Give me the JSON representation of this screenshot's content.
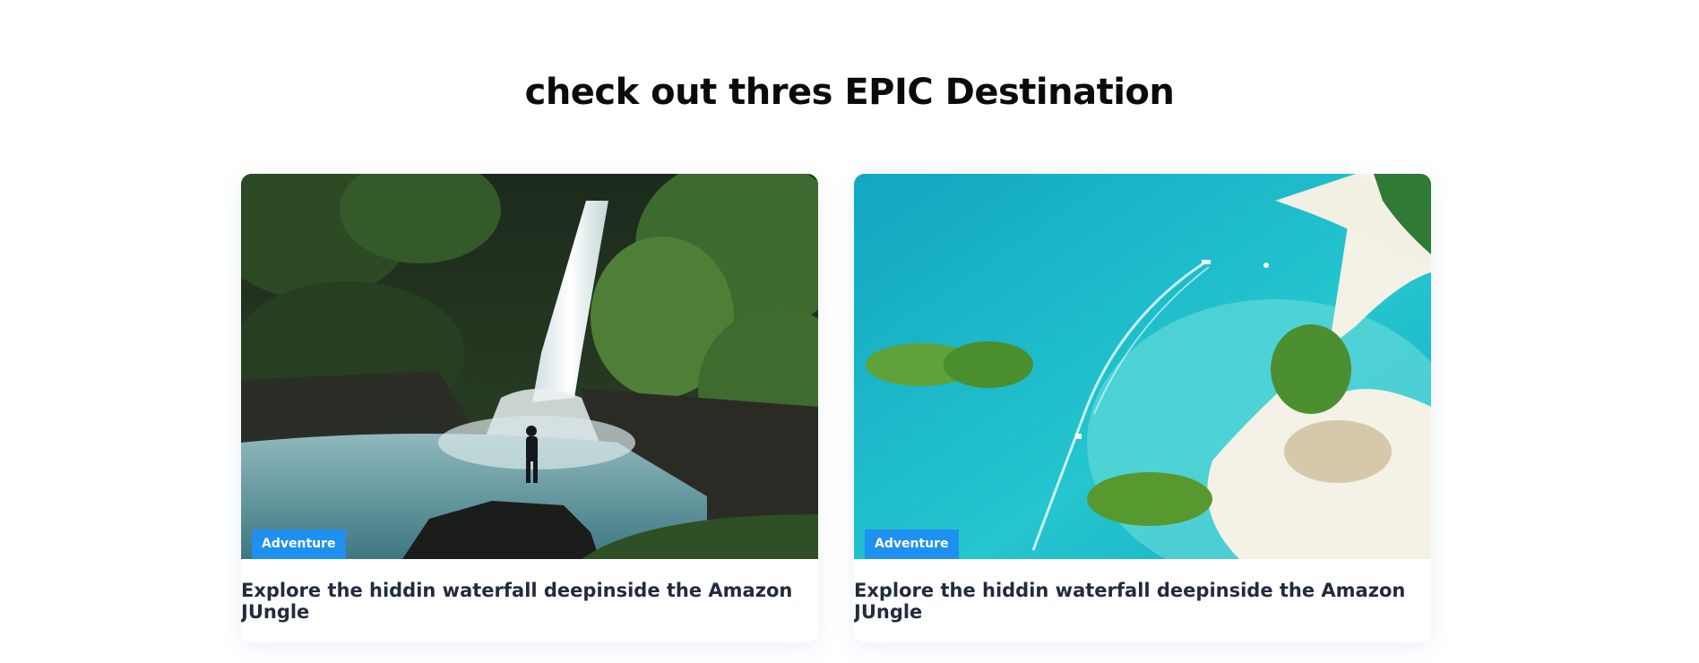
{
  "section": {
    "title": "check out thres EPIC Destination"
  },
  "cards": [
    {
      "tag": "Adventure",
      "caption": "Explore the hiddin waterfall deepinside the Amazon JUngle",
      "image": "waterfall-jungle-photo"
    },
    {
      "tag": "Adventure",
      "caption": "Explore the hiddin waterfall deepinside the Amazon JUngle",
      "image": "tropical-islands-aerial-photo"
    }
  ],
  "colors": {
    "tag_background": "#1e90f0",
    "caption_text": "#232b3e",
    "title_text": "#0b0b0b"
  }
}
